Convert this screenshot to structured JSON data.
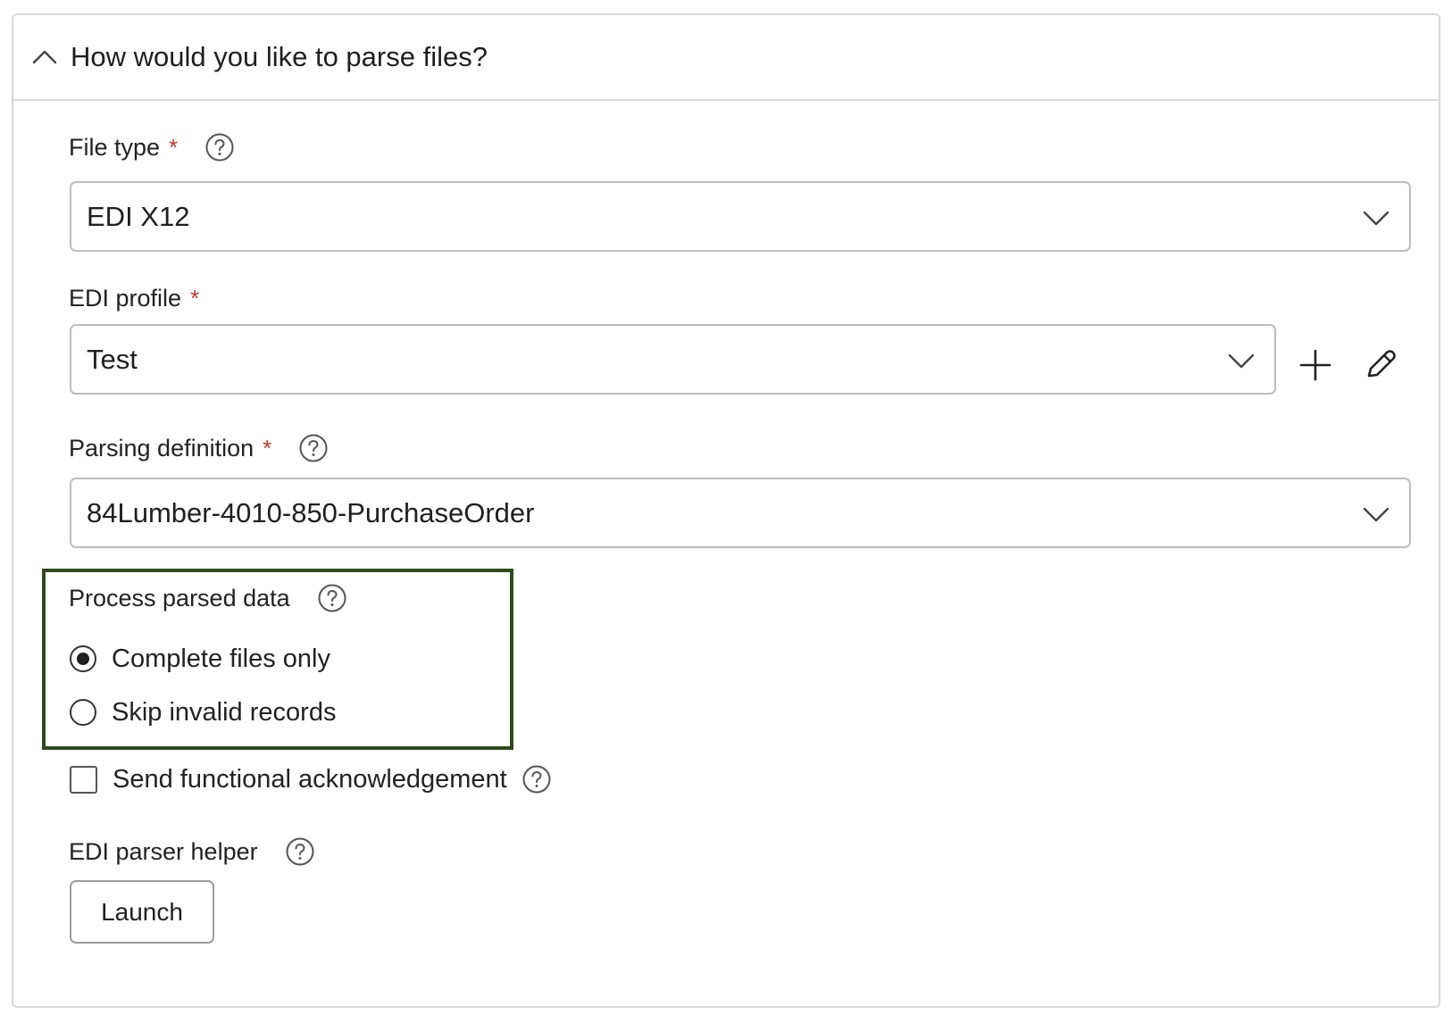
{
  "section": {
    "title": "How would you like to parse files?",
    "collapse_icon": "chevron-up-icon"
  },
  "file_type": {
    "label": "File type",
    "required_mark": "*",
    "value": "EDI X12"
  },
  "edi_profile": {
    "label": "EDI profile",
    "required_mark": "*",
    "value": "Test",
    "add_icon": "plus-icon",
    "edit_icon": "pencil-icon"
  },
  "parsing_definition": {
    "label": "Parsing definition",
    "required_mark": "*",
    "value": "84Lumber-4010-850-PurchaseOrder"
  },
  "process_parsed_data": {
    "label": "Process parsed data",
    "options": [
      {
        "label": "Complete files only",
        "selected": true
      },
      {
        "label": "Skip invalid records",
        "selected": false
      }
    ],
    "highlight_color": "#2f4a1e"
  },
  "functional_ack": {
    "label": "Send functional acknowledgement",
    "checked": false
  },
  "parser_helper": {
    "label": "EDI parser helper",
    "button_label": "Launch"
  },
  "colors": {
    "required": "#c0392b",
    "border": "#bdbdbd"
  }
}
